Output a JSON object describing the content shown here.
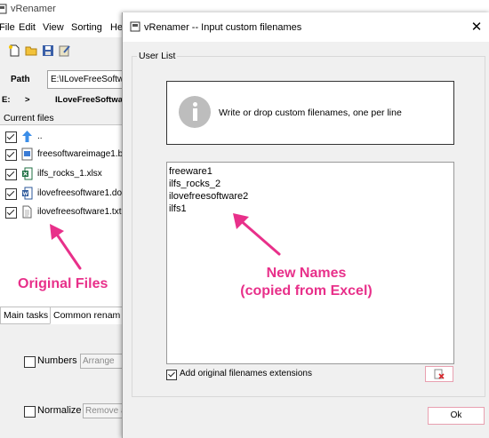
{
  "main_window": {
    "title": "vRenamer",
    "menu": [
      "File",
      "Edit",
      "View",
      "Sorting",
      "He"
    ],
    "path_label": "Path",
    "path_value": "E:\\ILoveFreeSoftw",
    "breadcrumb": {
      "drive": "E:",
      "sep": ">",
      "folder": "ILoveFreeSoftware"
    },
    "current_files_label": "Current files",
    "files": [
      {
        "name": "..",
        "icon": "folder-up-icon",
        "checked": true
      },
      {
        "name": "freesoftwareimage1.b",
        "icon": "image-file-icon",
        "checked": true
      },
      {
        "name": "ilfs_rocks_1.xlsx",
        "icon": "excel-file-icon",
        "checked": true
      },
      {
        "name": "ilovefreesoftware1.do",
        "icon": "word-file-icon",
        "checked": true
      },
      {
        "name": "ilovefreesoftware1.txt",
        "icon": "text-file-icon",
        "checked": true
      }
    ],
    "annotation_left": "Original Files",
    "tabs": [
      "Main tasks",
      "Common renam"
    ],
    "options": [
      {
        "label": "Numbers",
        "dropdown": "Arrange"
      },
      {
        "label": "Normalize",
        "dropdown": "Remove a"
      }
    ]
  },
  "dialog": {
    "title": "vRenamer -- Input custom filenames",
    "group_label": "User List",
    "info_text": "Write or drop custom filenames, one per line",
    "names": [
      "freeware1",
      "ilfs_rocks_2",
      "ilovefreesoftware2",
      "ilfs1"
    ],
    "annotation": {
      "line1": "New Names",
      "line2": "(copied from Excel)"
    },
    "ext_checkbox_label": "Add original filenames extensions",
    "ok_label": "Ok"
  },
  "colors": {
    "annotation": "#e8308a",
    "dialog_bg": "#f0f0f0"
  }
}
